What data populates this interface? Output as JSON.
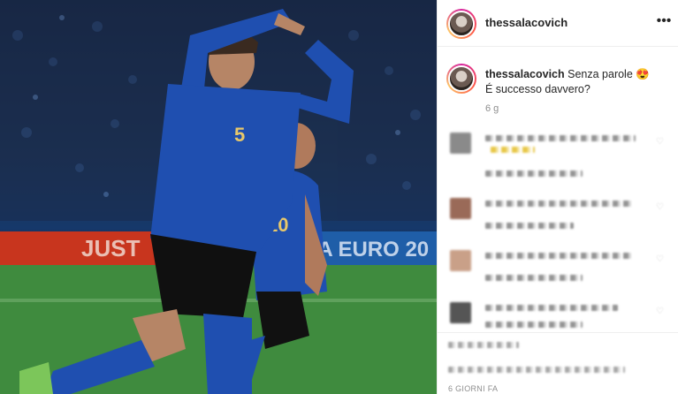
{
  "post": {
    "username": "thessalacovich",
    "caption_line1": "Senza parole 😍",
    "caption_line2": "É successo davvero?",
    "caption_time": "6 g",
    "posted_ago": "6 GIORNI FA",
    "more_icon": "more-horizontal-icon",
    "more_glyph": "•••"
  },
  "photo": {
    "board_text_left": "JUST",
    "board_text_right": "EFA EURO 20",
    "player_front_number": "5",
    "player_back_number": "10"
  },
  "comments": [
    {
      "id": "c1"
    },
    {
      "id": "c2"
    },
    {
      "id": "c3"
    },
    {
      "id": "c4"
    }
  ],
  "colors": {
    "accent_blue": "#0095f6",
    "text": "#262626",
    "secondary_text": "#8e8e8e",
    "divider": "#efefef",
    "jersey_blue": "#1f4fb0"
  }
}
